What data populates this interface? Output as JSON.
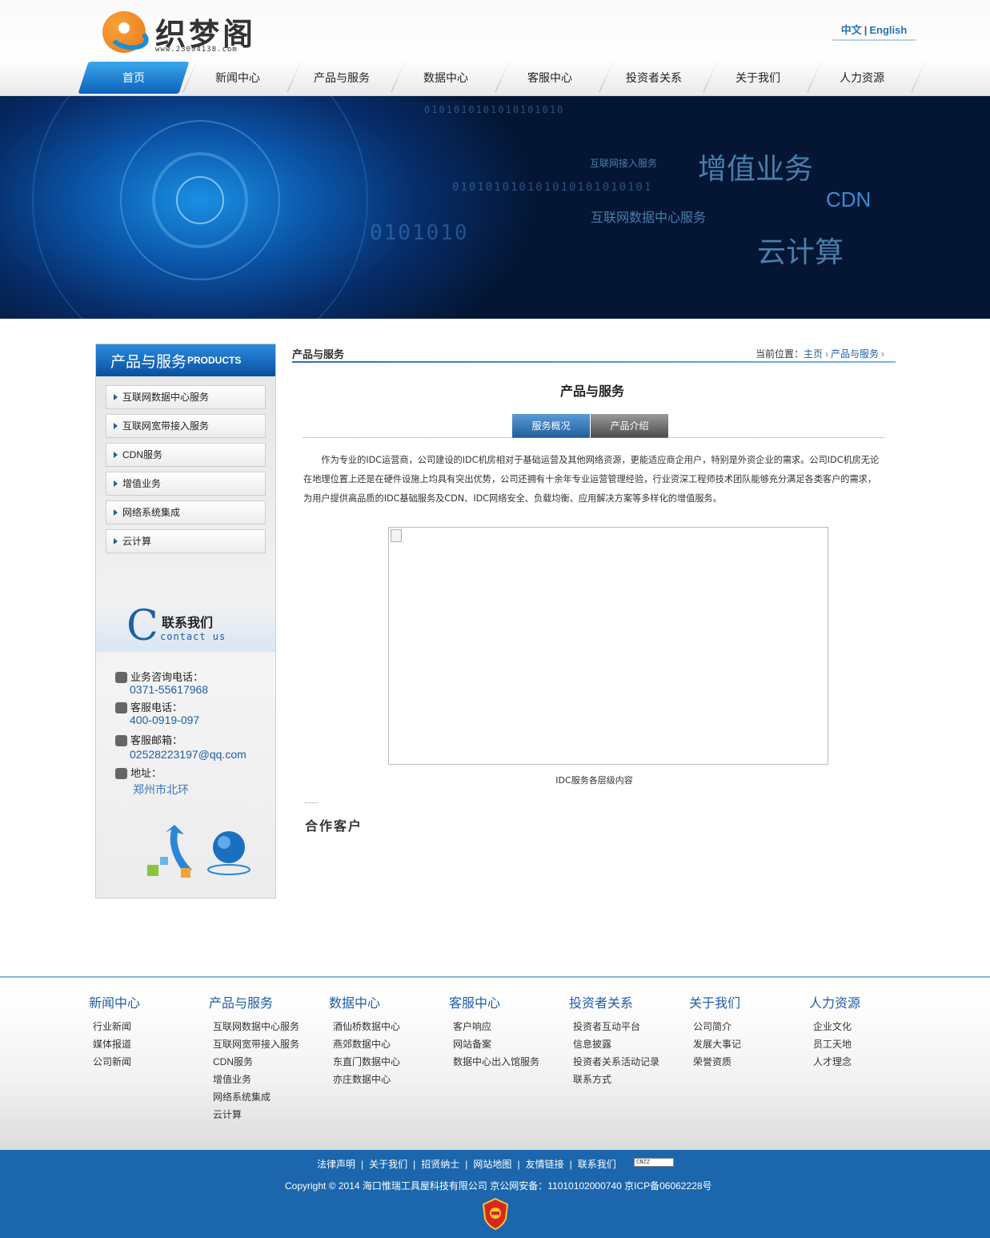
{
  "header": {
    "logo_name": "织梦阁",
    "logo_url": "www.23094138.com",
    "lang_cn": "中文",
    "lang_sep": "|",
    "lang_en": "English"
  },
  "nav": [
    "首页",
    "新闻中心",
    "产品与服务",
    "数据中心",
    "客服中心",
    "投资者关系",
    "关于我们",
    "人力资源"
  ],
  "banner": {
    "bits_1": "0101010101010101010",
    "bits_2": "010101010101010101010101",
    "bits_3": "0101010",
    "t_access": "互联网接入服务",
    "t_value": "增值业务",
    "t_cdn": "CDN",
    "t_idc": "互联网数据中心服务",
    "t_cloud": "云计算"
  },
  "sidebar": {
    "title_cn": "产品与服务",
    "title_en": "PRODUCTS",
    "items": [
      "互联网数据中心服务",
      "互联网宽带接入服务",
      "CDN服务",
      "增值业务",
      "网络系统集成",
      "云计算"
    ],
    "contact": {
      "c_letter": "C",
      "title_cn": "联系我们",
      "title_en": "contact us",
      "phone_label": "业务咨询电话：",
      "phone": "0371-55617968",
      "service_label": "客服电话：",
      "service_phone": "400-0919-097",
      "email_label": "客服邮箱：",
      "email": "02528223197@qq.com",
      "address_label": "地址：",
      "address": "郑州市北环"
    }
  },
  "main": {
    "section_title": "产品与服务",
    "breadcrumb_label": "当前位置：",
    "breadcrumb_home": "主页",
    "breadcrumb_current": "产品与服务",
    "content_title": "产品与服务",
    "tabs": [
      "服务概况",
      "产品介绍"
    ],
    "paragraph": "作为专业的IDC运营商，公司建设的IDC机房相对于基础运营及其他网络资源，更能适应商企用户，特别是外资企业的需求。公司IDC机房无论在地理位置上还是在硬件设施上均具有突出优势，公司还拥有十余年专业运营管理经验，行业资深工程师技术团队能够充分满足各类客户的需求，为用户提供高品质的IDC基础服务及CDN、IDC网络安全、负载均衡、应用解决方案等多样化的增值服务。",
    "image_caption": "IDC服务各层级内容",
    "partners_title": "合作客户"
  },
  "footer": {
    "columns": [
      {
        "title": "新闻中心",
        "links": [
          "行业新闻",
          "媒体报道",
          "公司新闻"
        ]
      },
      {
        "title": "产品与服务",
        "links": [
          "互联网数据中心服务",
          "互联网宽带接入服务",
          "CDN服务",
          "增值业务",
          "网络系统集成",
          "云计算"
        ]
      },
      {
        "title": "数据中心",
        "links": [
          "酒仙桥数据中心",
          "燕郊数据中心",
          "东直门数据中心",
          "亦庄数据中心"
        ]
      },
      {
        "title": "客服中心",
        "links": [
          "客户响应",
          "网站备案",
          "数据中心出入馆服务"
        ]
      },
      {
        "title": "投资者关系",
        "links": [
          "投资者互动平台",
          "信息披露",
          "投资者关系活动记录",
          "联系方式"
        ]
      },
      {
        "title": "关于我们",
        "links": [
          "公司简介",
          "发展大事记",
          "荣誉资质"
        ]
      },
      {
        "title": "人力资源",
        "links": [
          "企业文化",
          "员工天地",
          "人才理念"
        ]
      }
    ],
    "bottom_links": [
      "法律声明",
      "关于我们",
      "招贤纳士",
      "网站地图",
      "友情链接",
      "联系我们"
    ],
    "cnzz": "CNZZ",
    "copyright": "Copyright © 2014  海口惟瑞工具屋科技有限公司  京公网安备：11010102000740  京ICP备06062228号"
  },
  "colors": {
    "brand_blue": "#1b66ad",
    "nav_active": "#0c63b8",
    "link_blue": "#1d5ea8"
  }
}
